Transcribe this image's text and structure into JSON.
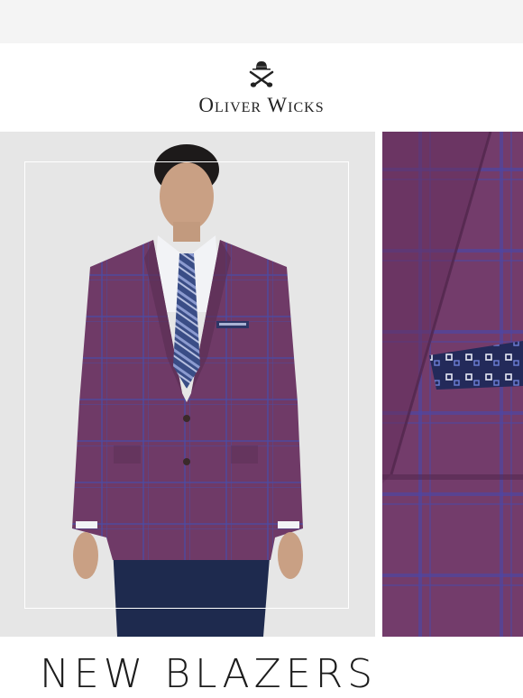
{
  "brand": {
    "name": "Oliver Wicks",
    "logo_icon": "hat-pipes-icon"
  },
  "hero": {
    "main_image": "model-in-purple-plaid-blazer",
    "detail_image": "blazer-lapel-pocket-square-closeup",
    "colors": {
      "background": "#e6e6e6",
      "blazer": "#6f3a67",
      "plaid_line": "#4a4aa8",
      "pants": "#1e2a4e"
    }
  },
  "headline": "NEW BLAZERS"
}
